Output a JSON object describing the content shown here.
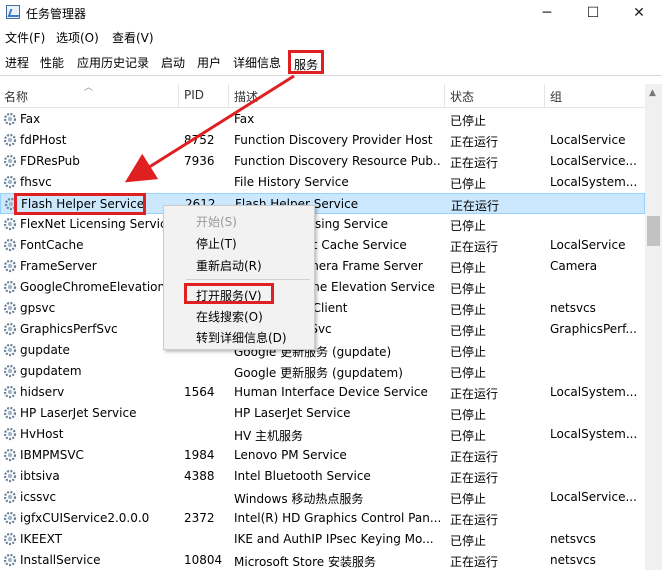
{
  "window": {
    "title": "任务管理器",
    "controls": {
      "minimize": "─",
      "maximize": "☐",
      "close": "✕"
    }
  },
  "menu": [
    "文件(F)",
    "选项(O)",
    "查看(V)"
  ],
  "tabs": [
    "进程",
    "性能",
    "应用历史记录",
    "启动",
    "用户",
    "详细信息",
    "服务"
  ],
  "active_tab": "服务",
  "columns": {
    "name": "名称",
    "pid": "PID",
    "desc": "描述",
    "status": "状态",
    "group": "组"
  },
  "rows": [
    {
      "name": "Fax",
      "pid": "",
      "desc": "Fax",
      "status": "已停止",
      "group": ""
    },
    {
      "name": "fdPHost",
      "pid": "8752",
      "desc": "Function Discovery Provider Host",
      "status": "正在运行",
      "group": "LocalService"
    },
    {
      "name": "FDResPub",
      "pid": "7936",
      "desc": "Function Discovery Resource Pub...",
      "status": "正在运行",
      "group": "LocalService..."
    },
    {
      "name": "fhsvc",
      "pid": "",
      "desc": "File History Service",
      "status": "已停止",
      "group": "LocalSystem..."
    },
    {
      "name": "Flash Helper Service",
      "pid": "2612",
      "desc": "Flash Helper Service",
      "status": "正在运行",
      "group": "",
      "selected": true
    },
    {
      "name": "FlexNet Licensing Service",
      "pid": "",
      "desc": "FlexNet Licensing Service",
      "status": "已停止",
      "group": ""
    },
    {
      "name": "FontCache",
      "pid": "",
      "desc": "Windows Font Cache Service",
      "status": "正在运行",
      "group": "LocalService"
    },
    {
      "name": "FrameServer",
      "pid": "",
      "desc": "Windows Camera Frame Server",
      "status": "已停止",
      "group": "Camera"
    },
    {
      "name": "GoogleChromeElevationService",
      "pid": "",
      "desc": "Google Chrome Elevation Service",
      "status": "已停止",
      "group": ""
    },
    {
      "name": "gpsvc",
      "pid": "",
      "desc": "Group Policy Client",
      "status": "已停止",
      "group": "netsvcs"
    },
    {
      "name": "GraphicsPerfSvc",
      "pid": "",
      "desc": "GraphicsPerfSvc",
      "status": "已停止",
      "group": "GraphicsPerf..."
    },
    {
      "name": "gupdate",
      "pid": "",
      "desc": "Google 更新服务 (gupdate)",
      "status": "已停止",
      "group": ""
    },
    {
      "name": "gupdatem",
      "pid": "",
      "desc": "Google 更新服务 (gupdatem)",
      "status": "已停止",
      "group": ""
    },
    {
      "name": "hidserv",
      "pid": "1564",
      "desc": "Human Interface Device Service",
      "status": "正在运行",
      "group": "LocalSystem..."
    },
    {
      "name": "HP LaserJet Service",
      "pid": "",
      "desc": "HP LaserJet Service",
      "status": "已停止",
      "group": ""
    },
    {
      "name": "HvHost",
      "pid": "",
      "desc": "HV 主机服务",
      "status": "已停止",
      "group": "LocalSystem..."
    },
    {
      "name": "IBMPMSVC",
      "pid": "1984",
      "desc": "Lenovo PM Service",
      "status": "正在运行",
      "group": ""
    },
    {
      "name": "ibtsiva",
      "pid": "4388",
      "desc": "Intel Bluetooth Service",
      "status": "正在运行",
      "group": ""
    },
    {
      "name": "icssvc",
      "pid": "",
      "desc": "Windows 移动热点服务",
      "status": "已停止",
      "group": "LocalService..."
    },
    {
      "name": "igfxCUIService2.0.0.0",
      "pid": "2372",
      "desc": "Intel(R) HD Graphics Control Pan...",
      "status": "正在运行",
      "group": ""
    },
    {
      "name": "IKEEXT",
      "pid": "",
      "desc": "IKE and AuthIP IPsec Keying Mo...",
      "status": "已停止",
      "group": "netsvcs"
    },
    {
      "name": "InstallService",
      "pid": "10804",
      "desc": "Microsoft Store 安装服务",
      "status": "正在运行",
      "group": "netsvcs"
    }
  ],
  "context_menu": {
    "items": [
      {
        "label": "开始(S)",
        "disabled": true
      },
      {
        "label": "停止(T)"
      },
      {
        "label": "重新启动(R)"
      },
      {
        "label": "打开服务(V)",
        "highlighted": true
      },
      {
        "label": "在线搜索(O)"
      },
      {
        "label": "转到详细信息(D)"
      }
    ]
  },
  "colors": {
    "highlight_box": "#e02020",
    "selected_row": "#cce8ff",
    "arrow": "#e02020"
  }
}
